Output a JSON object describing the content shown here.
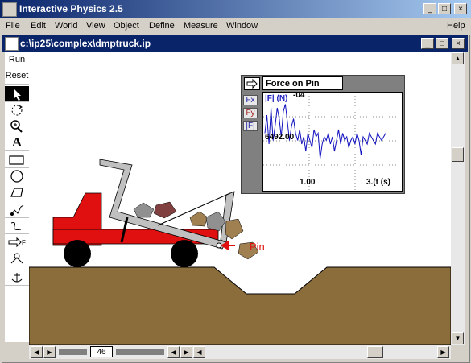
{
  "app": {
    "title": "Interactive Physics 2.5",
    "help": "Help"
  },
  "menu": [
    "File",
    "Edit",
    "World",
    "View",
    "Object",
    "Define",
    "Measure",
    "Window"
  ],
  "document": {
    "title": "c:\\ip25\\complex\\dmptruck.ip"
  },
  "toolbar": {
    "run": "Run",
    "reset": "Reset",
    "text_tool": "A"
  },
  "canvas": {
    "pin_label": "Pin"
  },
  "meter": {
    "title": "Force on Pin",
    "buttons": [
      "Fx",
      "Fy",
      "|F|"
    ],
    "legend": "|F| (N)",
    "y_value_top": "-04",
    "y_value_mid": "6492.00",
    "x_tick_1": "1.00",
    "x_tick_2": "3.(t (s)"
  },
  "frame_counter": "46",
  "chart_data": {
    "type": "line",
    "title": "Force on Pin",
    "series": [
      {
        "name": "|F| (N)",
        "values": [
          0.45,
          0.2,
          0.6,
          0.1,
          0.55,
          0.35,
          0.1,
          0.25,
          0.5,
          0.15,
          0.05,
          0.3,
          0.55,
          0.35,
          0.25,
          0.45,
          0.55,
          0.4,
          0.6,
          0.5,
          0.7,
          0.45,
          0.55,
          0.65,
          0.4,
          0.5,
          0.45,
          0.8,
          0.6,
          0.5,
          0.55,
          0.45,
          0.6,
          0.5,
          0.7,
          0.55,
          0.4,
          0.6,
          0.45,
          0.55,
          0.5,
          0.65,
          0.55,
          0.5,
          0.6,
          0.45,
          0.55,
          0.75,
          0.5,
          0.55,
          0.6,
          0.45,
          0.5,
          0.55,
          0.6,
          0.45,
          0.5,
          0.55,
          0.5,
          0.45
        ]
      }
    ],
    "xlabel": "t (s)",
    "ylabel": "|F| (N)"
  }
}
